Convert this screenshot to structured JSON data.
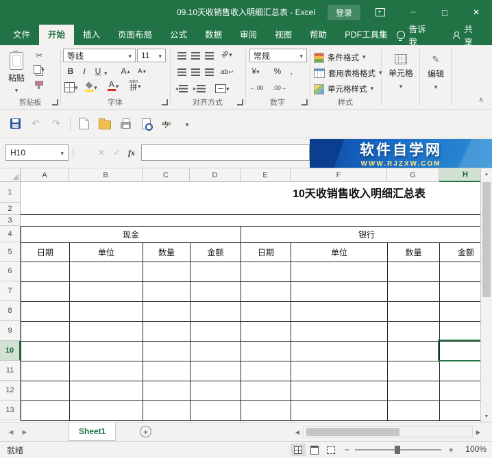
{
  "accent_color": "#217346",
  "titlebar": {
    "title": "09.10天收销售收入明细汇总表 - Excel",
    "login_label": "登录"
  },
  "ribbon": {
    "tabs": [
      {
        "label": "文件"
      },
      {
        "label": "开始",
        "active": true
      },
      {
        "label": "插入"
      },
      {
        "label": "页面布局"
      },
      {
        "label": "公式"
      },
      {
        "label": "数据"
      },
      {
        "label": "审阅"
      },
      {
        "label": "视图"
      },
      {
        "label": "帮助"
      },
      {
        "label": "PDF工具集"
      }
    ],
    "tell_me_label": "告诉我",
    "share_label": "共享",
    "groups": {
      "clipboard": {
        "label": "剪贴板",
        "paste_label": "粘贴"
      },
      "font": {
        "label": "字体",
        "font_name": "等线",
        "font_size": "11",
        "phonetic_label": "拼",
        "phonetic_ruby": "wén"
      },
      "alignment": {
        "label": "对齐方式"
      },
      "number": {
        "label": "数字",
        "format": "常规"
      },
      "styles": {
        "label": "样式",
        "conditional_label": "条件格式",
        "format_table_label": "套用表格格式",
        "cell_styles_label": "单元格样式"
      },
      "cells": {
        "label": "单元格"
      },
      "editing": {
        "label": "编辑"
      }
    }
  },
  "icons": {
    "bold": "B",
    "italic": "I",
    "underline": "U",
    "letter_a": "A",
    "accounting": "¥",
    "percent": "%",
    "comma": ",",
    "increase_decimal": "←.00",
    "decrease_decimal": ".00→",
    "wrap_text": "ab",
    "orientation": "ab",
    "spell": "abc"
  },
  "formula_bar": {
    "name_box": "H10",
    "fx_label": "fx",
    "formula_value": ""
  },
  "watermark": {
    "brand": "软件自学网",
    "url": "WWW.RJZXW.COM"
  },
  "grid": {
    "column_headers": [
      "A",
      "B",
      "C",
      "D",
      "E",
      "F",
      "G",
      "H"
    ],
    "row_headers": [
      "1",
      "2",
      "3",
      "4",
      "5",
      "6",
      "7",
      "8",
      "9",
      "10",
      "11",
      "12",
      "13"
    ],
    "selected_column": "H",
    "selected_row": "10",
    "active_cell": "H10",
    "sheet_title": "10天收销售收入明细汇总表",
    "table": {
      "section_headers": [
        {
          "label": "现金"
        },
        {
          "label": "银行"
        }
      ],
      "column_titles": [
        "日期",
        "单位",
        "数量",
        "金额",
        "日期",
        "单位",
        "数量",
        "金额"
      ],
      "empty_rows": [
        "6",
        "7",
        "8",
        "9",
        "10",
        "11",
        "12",
        "13"
      ]
    }
  },
  "sheet_bar": {
    "tabs": [
      {
        "label": "Sheet1",
        "active": true
      }
    ]
  },
  "status_bar": {
    "ready_label": "就绪",
    "zoom_label": "100%"
  }
}
